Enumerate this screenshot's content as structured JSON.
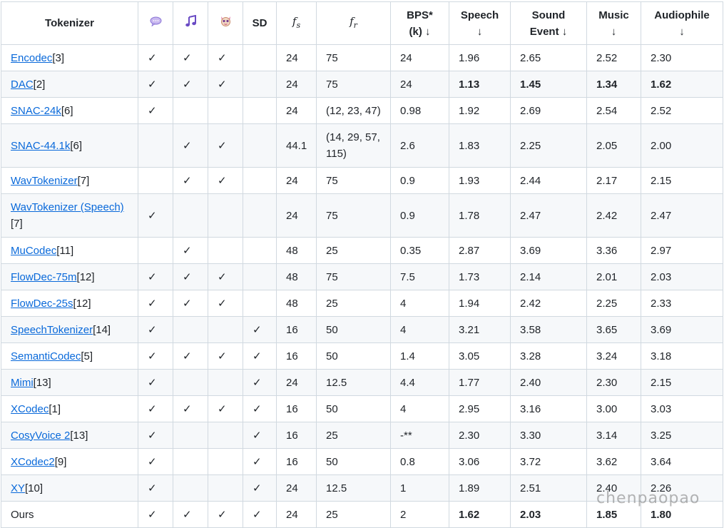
{
  "header": {
    "tokenizer": "Tokenizer",
    "sd": "SD",
    "fs": "f",
    "fs_sub": "s",
    "fr": "f",
    "fr_sub": "r",
    "bps": "BPS*",
    "bps_sub": "(k) ↓",
    "speech": "Speech",
    "speech_sub": "↓",
    "sound": "Sound",
    "sound_sub": "Event ↓",
    "music": "Music",
    "music_sub": "↓",
    "audiophile": "Audiophile",
    "audiophile_sub": "↓",
    "icons": [
      "speech-bubble-icon",
      "music-note-icon",
      "animal-icon"
    ]
  },
  "check_mark": "✓",
  "rows": [
    {
      "name": "Encodec",
      "ref": "[3]",
      "speech": "✓",
      "music": "✓",
      "general": "✓",
      "sd": "",
      "fs": "24",
      "fr": "75",
      "bps": "24",
      "m_speech": "1.96",
      "m_sound": "2.65",
      "m_music": "2.52",
      "m_audio": "2.30"
    },
    {
      "name": "DAC",
      "ref": "[2]",
      "speech": "✓",
      "music": "✓",
      "general": "✓",
      "sd": "",
      "fs": "24",
      "fr": "75",
      "bps": "24",
      "m_speech": "1.13",
      "m_sound": "1.45",
      "m_music": "1.34",
      "m_audio": "1.62"
    },
    {
      "name": "SNAC-24k",
      "ref": "[6]",
      "speech": "✓",
      "music": "",
      "general": "",
      "sd": "",
      "fs": "24",
      "fr": "(12, 23, 47)",
      "bps": "0.98",
      "m_speech": "1.92",
      "m_sound": "2.69",
      "m_music": "2.54",
      "m_audio": "2.52"
    },
    {
      "name": "SNAC-44.1k",
      "ref": "[6]",
      "speech": "",
      "music": "✓",
      "general": "✓",
      "sd": "",
      "fs": "44.1",
      "fr": "(14, 29, 57, 115)",
      "bps": "2.6",
      "m_speech": "1.83",
      "m_sound": "2.25",
      "m_music": "2.05",
      "m_audio": "2.00"
    },
    {
      "name": "WavTokenizer",
      "ref": "[7]",
      "speech": "",
      "music": "✓",
      "general": "✓",
      "sd": "",
      "fs": "24",
      "fr": "75",
      "bps": "0.9",
      "m_speech": "1.93",
      "m_sound": "2.44",
      "m_music": "2.17",
      "m_audio": "2.15"
    },
    {
      "name": "WavTokenizer (Speech)",
      "ref": "[7]",
      "speech": "✓",
      "music": "",
      "general": "",
      "sd": "",
      "fs": "24",
      "fr": "75",
      "bps": "0.9",
      "m_speech": "1.78",
      "m_sound": "2.47",
      "m_music": "2.42",
      "m_audio": "2.47"
    },
    {
      "name": "MuCodec",
      "ref": "[11]",
      "speech": "",
      "music": "✓",
      "general": "",
      "sd": "",
      "fs": "48",
      "fr": "25",
      "bps": "0.35",
      "m_speech": "2.87",
      "m_sound": "3.69",
      "m_music": "3.36",
      "m_audio": "2.97"
    },
    {
      "name": "FlowDec-75m",
      "ref": "[12]",
      "speech": "✓",
      "music": "✓",
      "general": "✓",
      "sd": "",
      "fs": "48",
      "fr": "75",
      "bps": "7.5",
      "m_speech": "1.73",
      "m_sound": "2.14",
      "m_music": "2.01",
      "m_audio": "2.03"
    },
    {
      "name": "FlowDec-25s",
      "ref": "[12]",
      "speech": "✓",
      "music": "✓",
      "general": "✓",
      "sd": "",
      "fs": "48",
      "fr": "25",
      "bps": "4",
      "m_speech": "1.94",
      "m_sound": "2.42",
      "m_music": "2.25",
      "m_audio": "2.33"
    },
    {
      "name": "SpeechTokenizer",
      "ref": "[14]",
      "speech": "✓",
      "music": "",
      "general": "",
      "sd": "✓",
      "fs": "16",
      "fr": "50",
      "bps": "4",
      "m_speech": "3.21",
      "m_sound": "3.58",
      "m_music": "3.65",
      "m_audio": "3.69"
    },
    {
      "name": "SemantiCodec",
      "ref": "[5]",
      "speech": "✓",
      "music": "✓",
      "general": "✓",
      "sd": "✓",
      "fs": "16",
      "fr": "50",
      "bps": "1.4",
      "m_speech": "3.05",
      "m_sound": "3.28",
      "m_music": "3.24",
      "m_audio": "3.18"
    },
    {
      "name": "Mimi",
      "ref": "[13]",
      "speech": "✓",
      "music": "",
      "general": "",
      "sd": "✓",
      "fs": "24",
      "fr": "12.5",
      "bps": "4.4",
      "m_speech": "1.77",
      "m_sound": "2.40",
      "m_music": "2.30",
      "m_audio": "2.15"
    },
    {
      "name": "XCodec",
      "ref": "[1]",
      "speech": "✓",
      "music": "✓",
      "general": "✓",
      "sd": "✓",
      "fs": "16",
      "fr": "50",
      "bps": "4",
      "m_speech": "2.95",
      "m_sound": "3.16",
      "m_music": "3.00",
      "m_audio": "3.03"
    },
    {
      "name": "CosyVoice 2",
      "ref": "[13]",
      "speech": "✓",
      "music": "",
      "general": "",
      "sd": "✓",
      "fs": "16",
      "fr": "25",
      "bps": "-**",
      "m_speech": "2.30",
      "m_sound": "3.30",
      "m_music": "3.14",
      "m_audio": "3.25"
    },
    {
      "name": "XCodec2",
      "ref": "[9]",
      "speech": "✓",
      "music": "",
      "general": "",
      "sd": "✓",
      "fs": "16",
      "fr": "50",
      "bps": "0.8",
      "m_speech": "3.06",
      "m_sound": "3.72",
      "m_music": "3.62",
      "m_audio": "3.64"
    },
    {
      "name": "XY",
      "ref": "[10]",
      "speech": "✓",
      "music": "",
      "general": "",
      "sd": "✓",
      "fs": "24",
      "fr": "12.5",
      "bps": "1",
      "m_speech": "1.89",
      "m_sound": "2.51",
      "m_music": "2.40",
      "m_audio": "2.26"
    },
    {
      "name": "Ours",
      "ref": "",
      "speech": "✓",
      "music": "✓",
      "general": "✓",
      "sd": "✓",
      "fs": "24",
      "fr": "25",
      "bps": "2",
      "m_speech": "1.62",
      "m_sound": "2.03",
      "m_music": "1.85",
      "m_audio": "1.80"
    }
  ],
  "watermark": "chenpaopao"
}
